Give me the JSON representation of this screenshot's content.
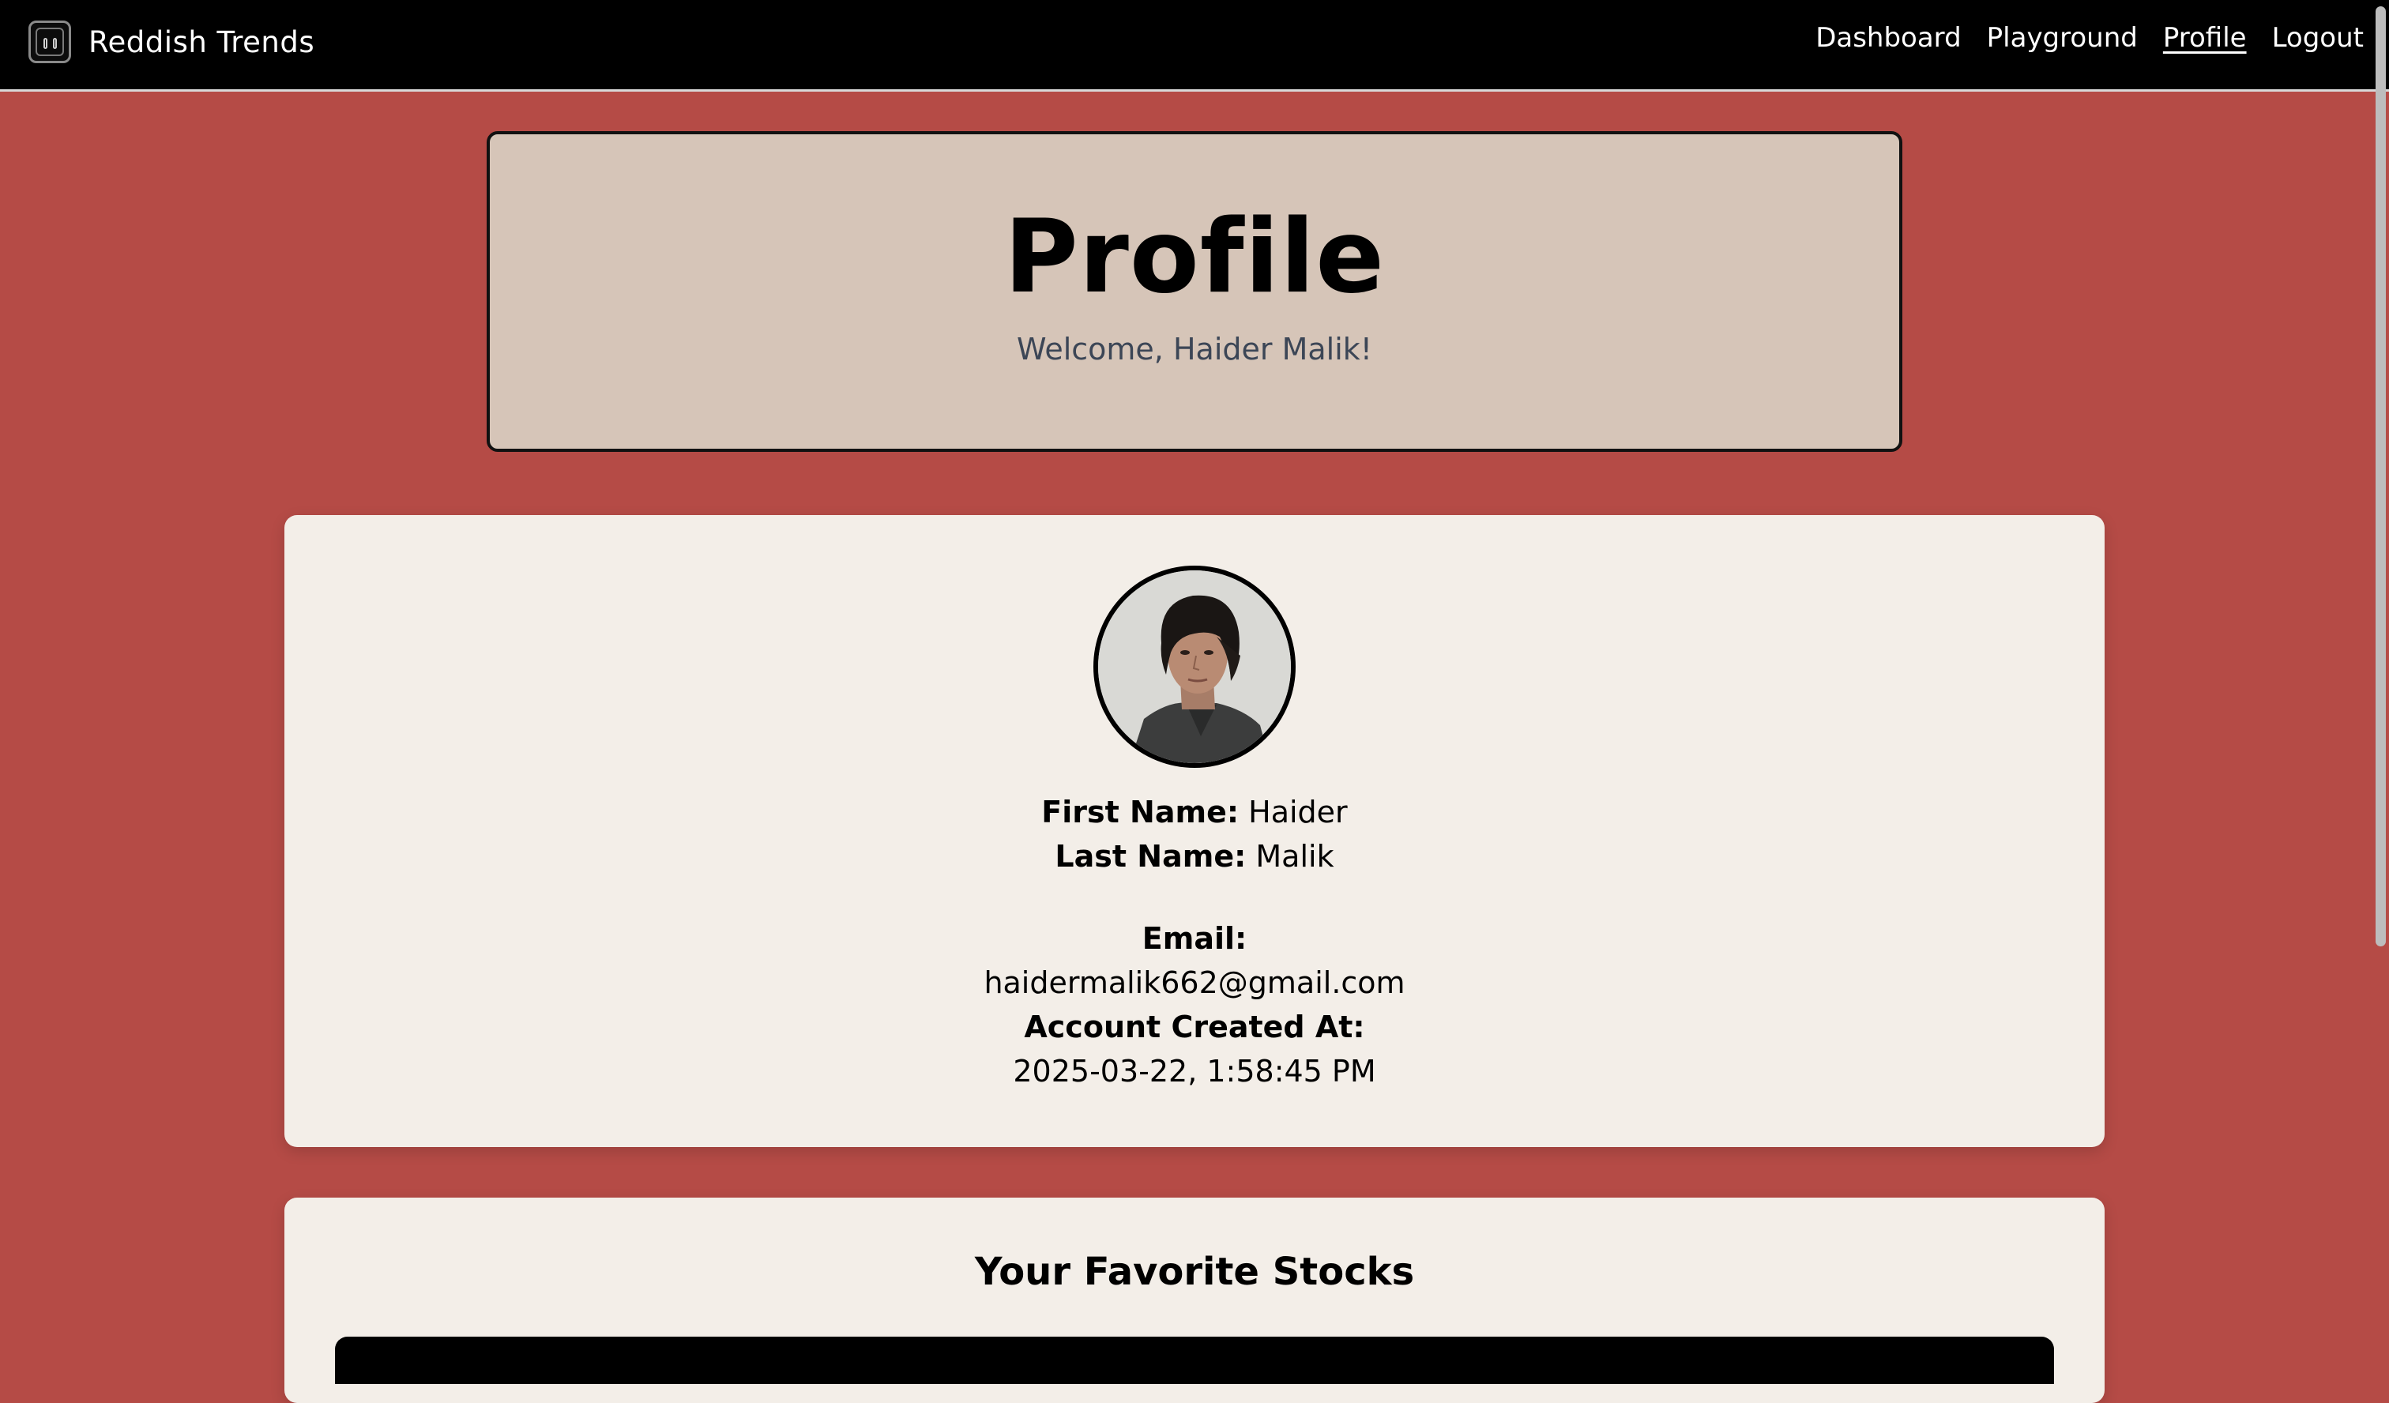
{
  "navbar": {
    "brand": "Reddish Trends",
    "links": [
      "Dashboard",
      "Playground",
      "Profile",
      "Logout"
    ],
    "active": "Profile"
  },
  "header": {
    "title": "Profile",
    "subtitle": "Welcome, Haider Malik!"
  },
  "profile": {
    "first_name_label": "First Name:",
    "first_name": "Haider",
    "last_name_label": "Last Name:",
    "last_name": "Malik",
    "email_label": "Email:",
    "email": "haidermalik662@gmail.com",
    "created_label": "Account Created At:",
    "created_at": "2025-03-22, 1:58:45 PM"
  },
  "stocks": {
    "title": "Your Favorite Stocks"
  },
  "colors": {
    "page_bg": "#b54b46",
    "navbar_bg": "#000000",
    "header_card_bg": "#d6c5b8",
    "content_card_bg": "#f3eee8",
    "subtitle_text": "#3c4656"
  },
  "icons": {
    "brand_logo": "reddish-logo-icon",
    "avatar": "user-avatar-photo"
  }
}
